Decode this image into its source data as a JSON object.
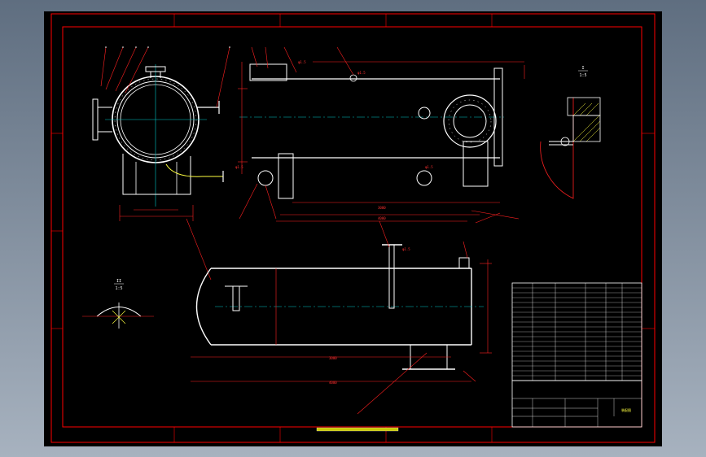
{
  "drawing": {
    "background": "#000000",
    "frame_color": "#ff0000",
    "body_color": "#ffffff",
    "center_color": "#00c8c8",
    "dim_color": "#ff2020",
    "hatch_color": "#ffff40",
    "table_text_color": "#30ff30"
  },
  "views": {
    "detail_i_mark": "I",
    "detail_i_scale": "1:5",
    "detail_ii_mark": "II",
    "detail_ii_scale": "1:5"
  },
  "title_block": {
    "title": "装配图"
  }
}
